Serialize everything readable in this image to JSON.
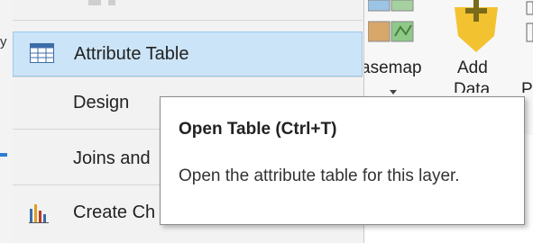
{
  "context_menu": {
    "items": [
      {
        "label": "Attribute Table",
        "icon": "table-grid-icon",
        "selected": true
      },
      {
        "label": "Design",
        "icon": ""
      },
      {
        "label": "Joins and",
        "icon": ""
      },
      {
        "label": "Create Ch",
        "icon": "bar-chart-icon"
      }
    ]
  },
  "ribbon": {
    "basemap_label": "asemap",
    "add_label": "Add",
    "data_label": "Data",
    "partial_label": "P"
  },
  "left_fragment": "y",
  "tooltip": {
    "title": "Open Table (Ctrl+T)",
    "body": "Open the attribute table for this layer."
  },
  "colors": {
    "selected_bg": "#cce4f7",
    "selected_border": "#99c9ef",
    "accent_blue": "#2d7dd2",
    "add_data_yellow": "#f2c230"
  }
}
